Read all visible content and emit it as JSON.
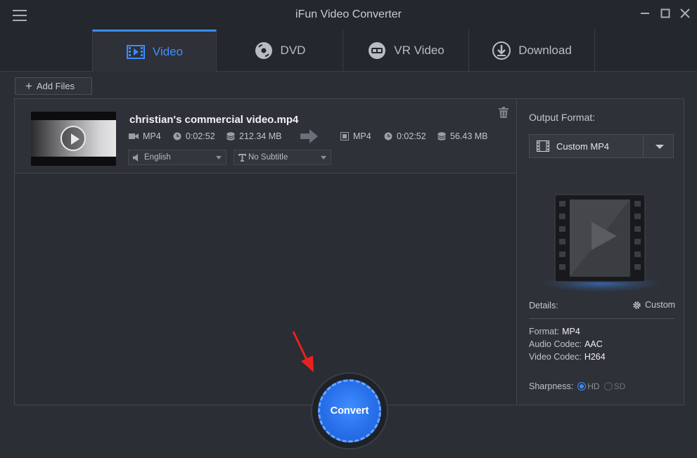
{
  "window": {
    "title": "iFun Video Converter",
    "menu_icon": "hamburger-menu-icon",
    "controls": [
      "minimize-icon",
      "maximize-icon",
      "close-icon"
    ]
  },
  "tabs": [
    {
      "label": "Video",
      "icon": "video-icon",
      "active": true
    },
    {
      "label": "DVD",
      "icon": "dvd-icon",
      "active": false
    },
    {
      "label": "VR Video",
      "icon": "vr-headset-icon",
      "active": false
    },
    {
      "label": "Download",
      "icon": "download-icon",
      "active": false
    }
  ],
  "toolbar": {
    "add_files_label": "Add Files"
  },
  "file": {
    "name": "christian's commercial video.mp4",
    "source": {
      "format": "MP4",
      "duration": "0:02:52",
      "size": "212.34 MB"
    },
    "target": {
      "format": "MP4",
      "duration": "0:02:52",
      "size": "56.43 MB"
    },
    "audio_track": "English",
    "subtitle": "No Subtitle"
  },
  "output": {
    "label": "Output Format:",
    "selected": "Custom MP4",
    "details_label": "Details:",
    "custom_label": "Custom",
    "specs": [
      {
        "label": "Format:",
        "value": "MP4"
      },
      {
        "label": "Audio Codec:",
        "value": "AAC"
      },
      {
        "label": "Video Codec:",
        "value": "H264"
      }
    ],
    "sharpness_label": "Sharpness:",
    "sharpness_options": [
      {
        "label": "HD",
        "selected": true
      },
      {
        "label": "SD",
        "selected": false
      }
    ]
  },
  "convert_label": "Convert",
  "colors": {
    "accent": "#3a8cff",
    "background": "#2b2e35",
    "annotation_arrow": "#e8211d"
  }
}
